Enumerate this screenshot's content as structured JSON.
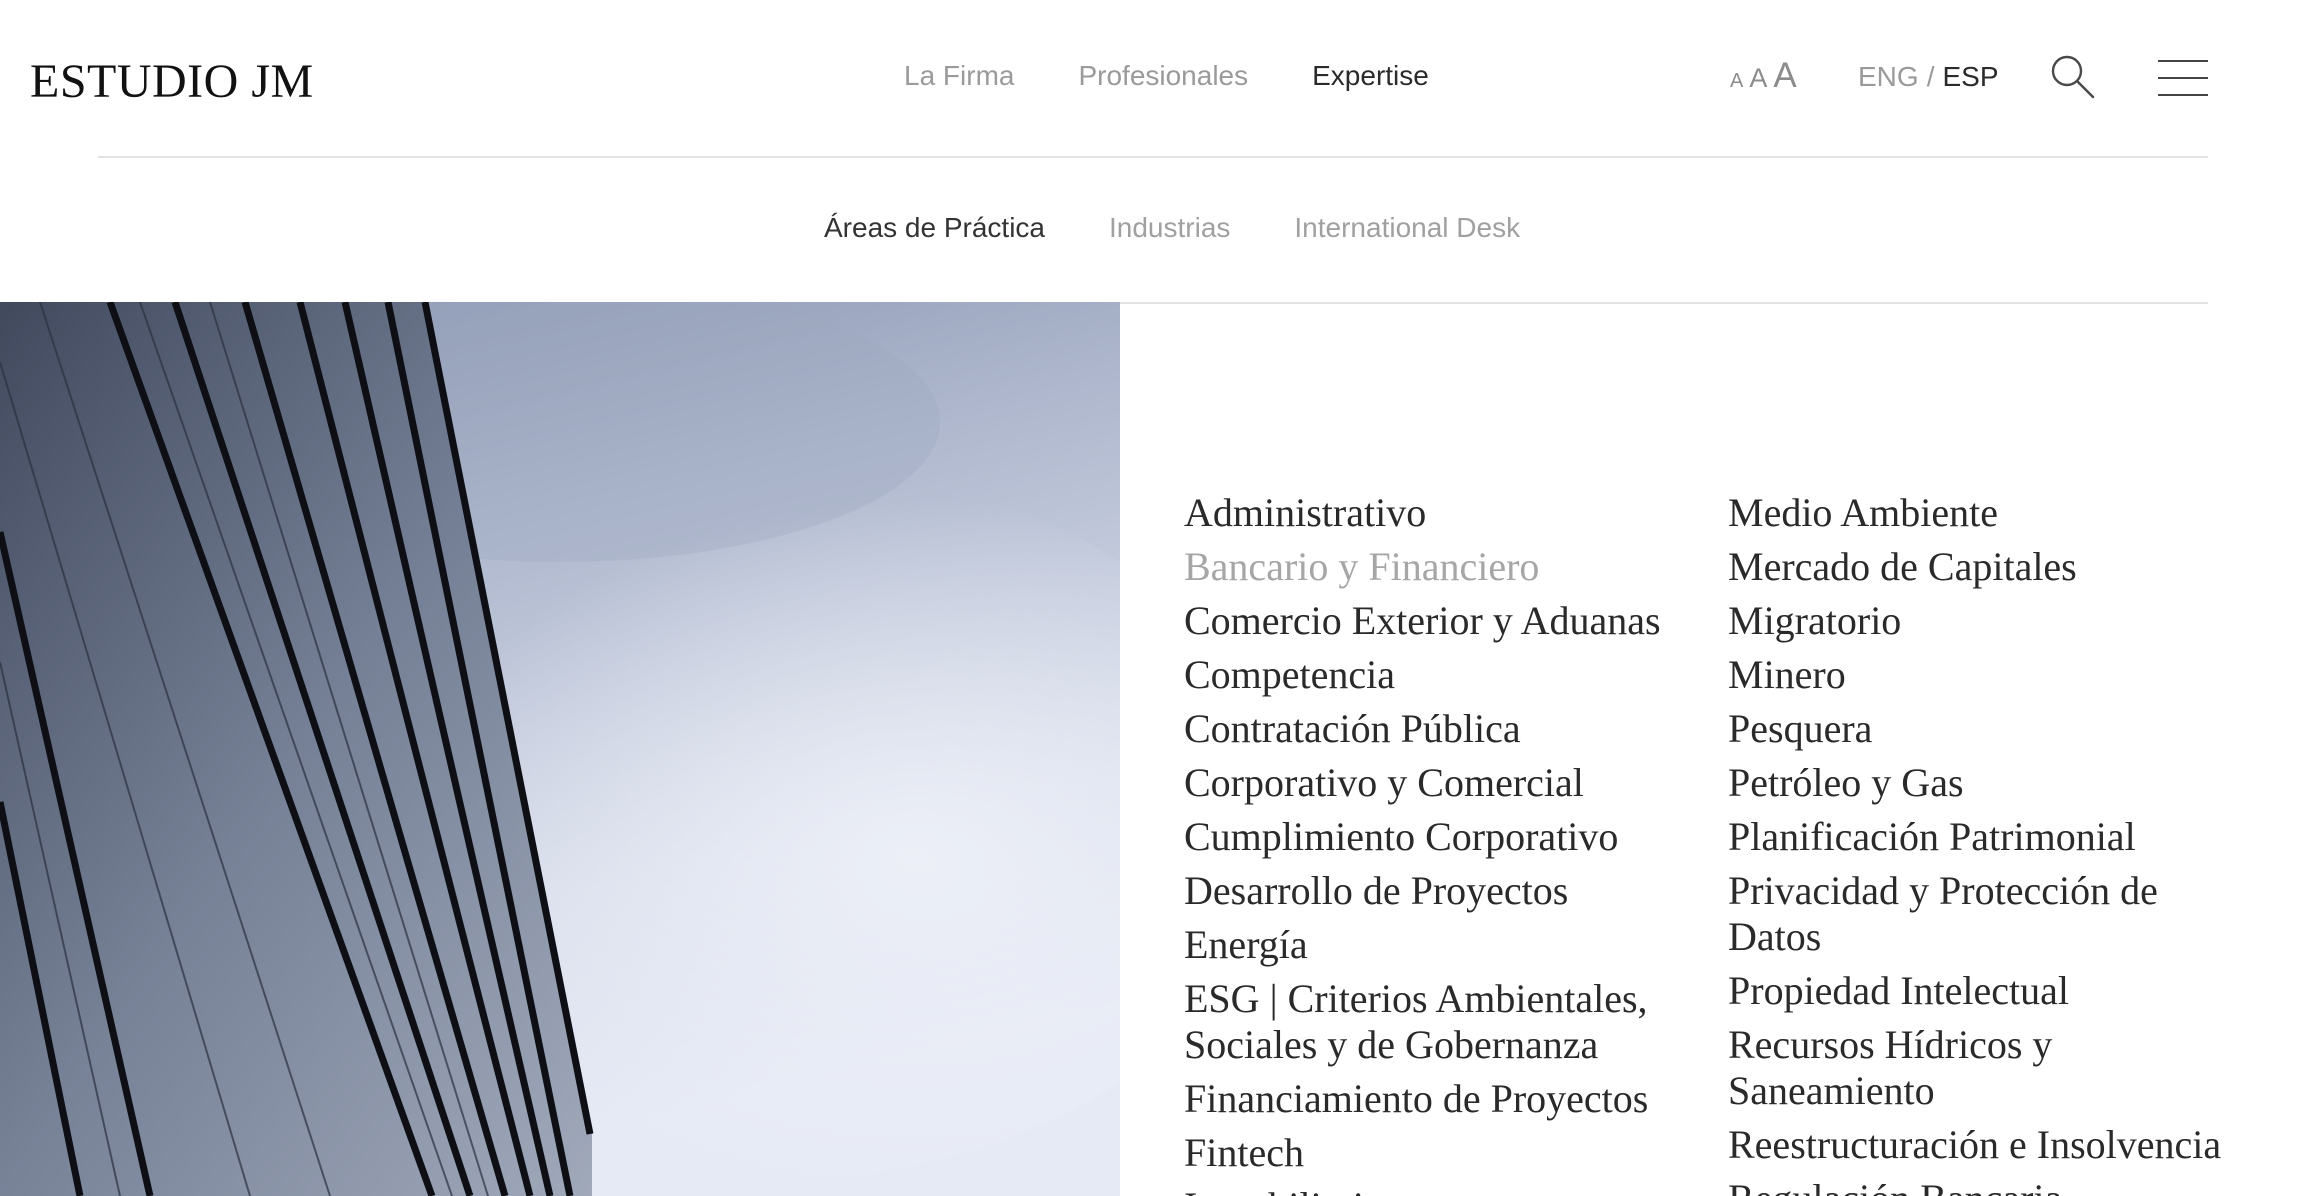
{
  "header": {
    "logo": "ESTUDIO JM",
    "nav": [
      "La Firma",
      "Profesionales",
      "Expertise"
    ],
    "font_size": {
      "small": "A",
      "medium": "A",
      "large": "A"
    },
    "lang": {
      "eng": "ENG",
      "separator": "/",
      "esp": "ESP"
    },
    "icons": {
      "search": "search-icon",
      "menu": "hamburger-menu-icon"
    }
  },
  "subnav": [
    "Áreas de Práctica",
    "Industrias",
    "International Desk"
  ],
  "areas": {
    "col1": [
      "Administrativo",
      "Bancario y Financiero",
      "Comercio Exterior y Aduanas",
      "Competencia",
      "Contratación Pública",
      "Corporativo y Comercial",
      "Cumplimiento Corporativo",
      "Desarrollo de Proyectos",
      "Energía",
      "ESG | Criterios Ambientales, Sociales y de Gobernanza",
      "Financiamiento de Proyectos",
      "Fintech",
      "Inmobiliario"
    ],
    "col2": [
      "Medio Ambiente",
      "Mercado de Capitales",
      "Migratorio",
      "Minero",
      "Pesquera",
      "Petróleo y Gas",
      "Planificación Patrimonial",
      "Privacidad y Protección de Datos",
      "Propiedad Intelectual",
      "Recursos Hídricos y Saneamiento",
      "Reestructuración e Insolvencia",
      "Regulación Bancaria"
    ]
  },
  "colors": {
    "text_dark": "#2a2a2a",
    "text_muted": "#a6a6a6",
    "divider": "#e3e3e3",
    "sky_top": "#8a97b2",
    "sky_bottom": "#e4e9f4"
  }
}
